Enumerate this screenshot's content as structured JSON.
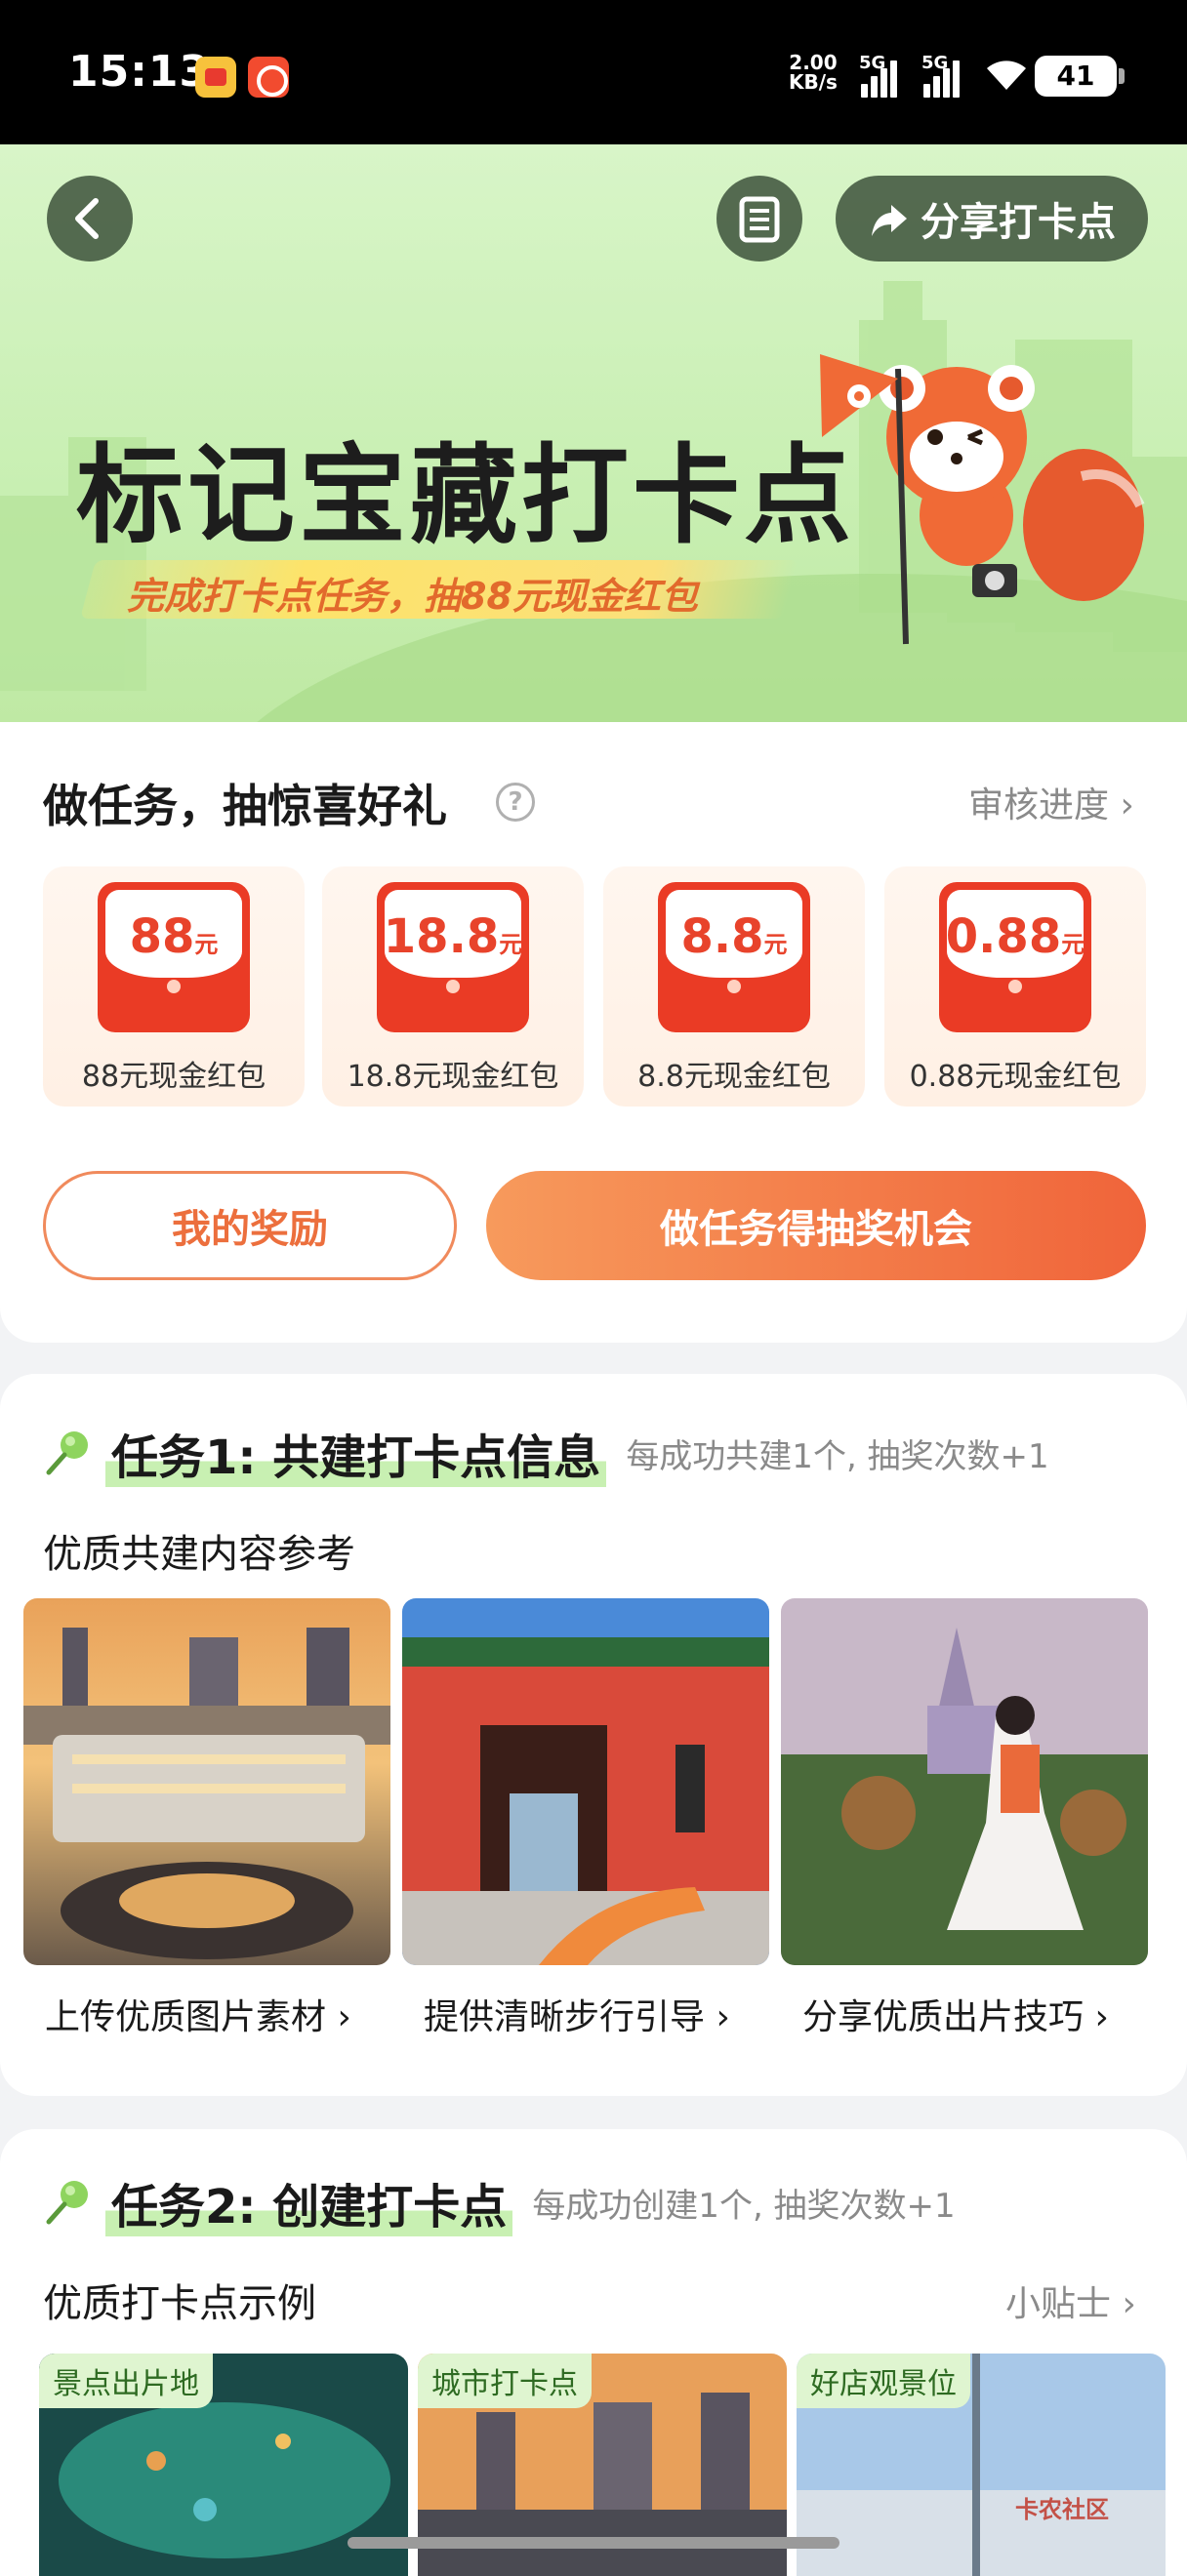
{
  "status_bar": {
    "time": "15:13",
    "net_speed_value": "2.00",
    "net_speed_unit": "KB/s",
    "signal1": "5G",
    "signal2": "5G",
    "battery": "41"
  },
  "header": {
    "share_label": "分享打卡点",
    "banner_title": "标记宝藏打卡点",
    "banner_subtitle": "完成打卡点任务，抽88元现金红包"
  },
  "rewards": {
    "title": "做任务，抽惊喜好礼",
    "review_link": "审核进度",
    "prizes": [
      {
        "amount": "88",
        "unit": "元",
        "label": "88元现金红包"
      },
      {
        "amount": "18.8",
        "unit": "元",
        "label": "18.8元现金红包"
      },
      {
        "amount": "8.8",
        "unit": "元",
        "label": "8.8元现金红包"
      },
      {
        "amount": "0.88",
        "unit": "元",
        "label": "0.88元现金红包"
      }
    ],
    "my_rewards_label": "我的奖励",
    "do_tasks_label": "做任务得抽奖机会"
  },
  "task1": {
    "title": "任务1: 共建打卡点信息",
    "note": "每成功共建1个, 抽奖次数+1",
    "subtitle": "优质共建内容参考",
    "items": [
      {
        "caption": "上传优质图片素材"
      },
      {
        "caption": "提供清晰步行引导"
      },
      {
        "caption": "分享优质出片技巧"
      }
    ]
  },
  "task2": {
    "title": "任务2: 创建打卡点",
    "note": "每成功创建1个, 抽奖次数+1",
    "subtitle": "优质打卡点示例",
    "tips_link": "小贴士",
    "examples": [
      {
        "tag": "景点出片地"
      },
      {
        "tag": "城市打卡点"
      },
      {
        "tag": "好店观景位"
      }
    ]
  },
  "watermark": "卡农社区",
  "colors": {
    "accent_orange": "#f0643a",
    "banner_green": "#c8efb2",
    "envelope_red": "#ea3b25"
  }
}
